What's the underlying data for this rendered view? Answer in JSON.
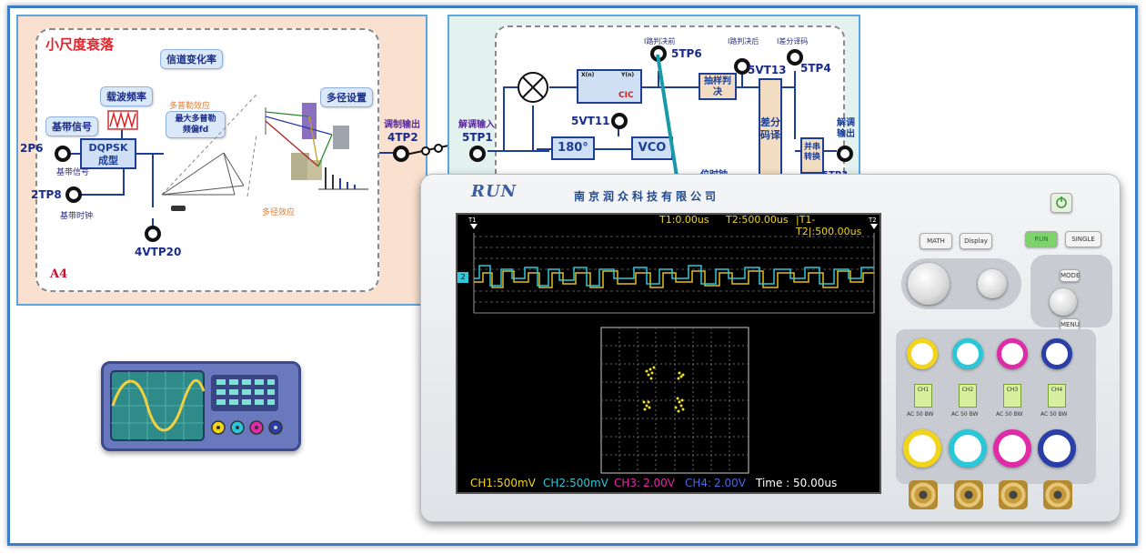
{
  "left_panel": {
    "title": "小尺度衰落",
    "channel_rate": "信道变化率",
    "carrier_freq": "载波频率",
    "doppler_label": "多普勒效应",
    "max_doppler": "最大多普勒频偏fd",
    "multipath_setting": "多径设置",
    "baseband_signal_pill": "基带信号",
    "dqpsk_line1": "DQPSK",
    "dqpsk_line2": "成型",
    "tp_2p6": "2P6",
    "tp_2p6_sub": "基带信号",
    "tp_2tp8": "2TP8",
    "tp_2tp8_sub": "基带时钟",
    "tp_4vtp20": "4VTP20",
    "multipath_effect": "多径效应",
    "a4_tag": "A4",
    "mod_out": "调制输出",
    "tp_4tp2": "4TP2"
  },
  "right_panel": {
    "demod_in": "解调输入",
    "tp_5tp1": "5TP1",
    "path_decision_pre": "I路判决前",
    "tp_5tp6": "5TP6",
    "path_decision_post": "I路判决后",
    "diff_decode": "I差分译码",
    "tp_5vt13": "5VT13",
    "tp_5tp4": "5TP4",
    "cic": "CIC",
    "xn": "X(n)",
    "yn": "Y(n)",
    "sample_decision": "抽样判决",
    "tp_5vt11": "5VT11",
    "phase_180": "180°",
    "vco": "VCO",
    "diff_decoder_box": "差分码译",
    "par_to_ser": "并串转换",
    "demod_out": "解调输出",
    "bit_clock": "位时钟",
    "tp_5tp3": "5TP3"
  },
  "scope": {
    "brand": "RUN",
    "company": "南京润众科技有限公司",
    "t1": "T1:0.00us",
    "t2": "T2:500.00us",
    "dt": "|T1-T2|:500.00us",
    "cursor1": "T1",
    "cursor2": "T2",
    "ch_marker": "2",
    "ch1": "CH1:500mV",
    "ch2": "CH2:500mV",
    "ch3_name": "CH3:",
    "ch3_val": "2.00V",
    "ch4_name": "CH4:",
    "ch4_val": "2.00V",
    "timebase": "Time : 50.00us",
    "buttons": {
      "math": "MATH",
      "display": "Display",
      "run": "RUN",
      "single": "SINGLE",
      "mode": "MODE",
      "menu": "MENU"
    },
    "channels": [
      "CH1",
      "CH2",
      "CH3",
      "CH4"
    ],
    "coupling": "AC 50 BW",
    "colors": {
      "ch1": "#f2d51b",
      "ch2": "#29c8d8",
      "ch3": "#e02aa8",
      "ch4": "#2a3ea8",
      "trace_yellow": "#e0c020",
      "trace_cyan": "#30c8d8"
    }
  }
}
